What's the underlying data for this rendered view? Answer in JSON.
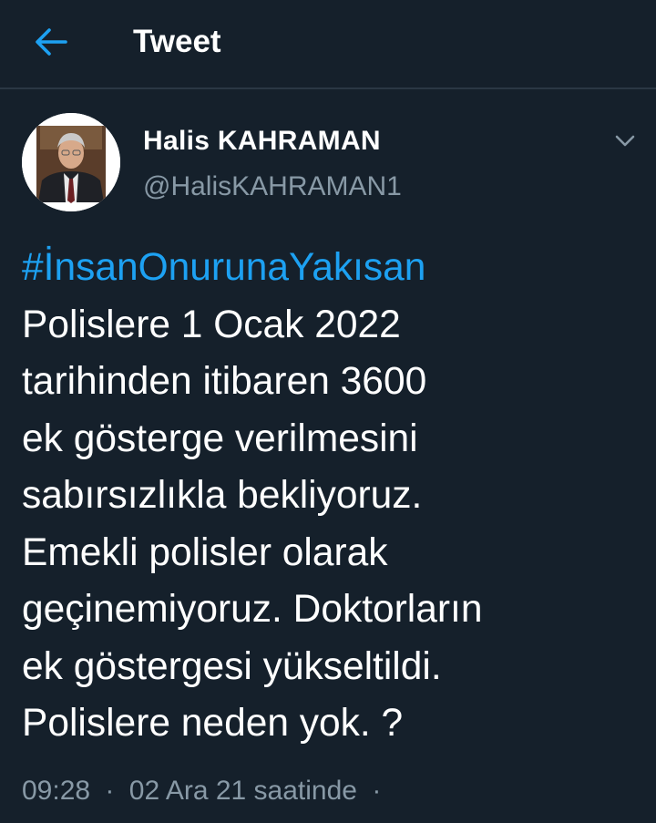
{
  "header": {
    "title": "Tweet"
  },
  "tweet": {
    "author_name": "Halis KAHRAMAN",
    "author_handle": "@HalisKAHRAMAN1",
    "hashtag": "#İnsanOnurunaYakısan",
    "lines": [
      "Polislere 1 Ocak 2022",
      "tarihinden itibaren 3600",
      "ek gösterge verilmesini",
      "sabırsızlıkla bekliyoruz.",
      "Emekli polisler olarak",
      "geçinemiyoruz. Doktorların",
      "ek göstergesi yükseltildi.",
      "Polislere neden yok. ?"
    ],
    "time": "09:28",
    "date": "02 Ara 21 saatinde",
    "dot": "·"
  },
  "icons": {
    "back": "arrow-left-icon",
    "menu": "chevron-down-icon"
  },
  "colors": {
    "background": "#15202b",
    "accent": "#1da1f2",
    "secondary_text": "#8899a6",
    "divider": "#2a3744"
  }
}
